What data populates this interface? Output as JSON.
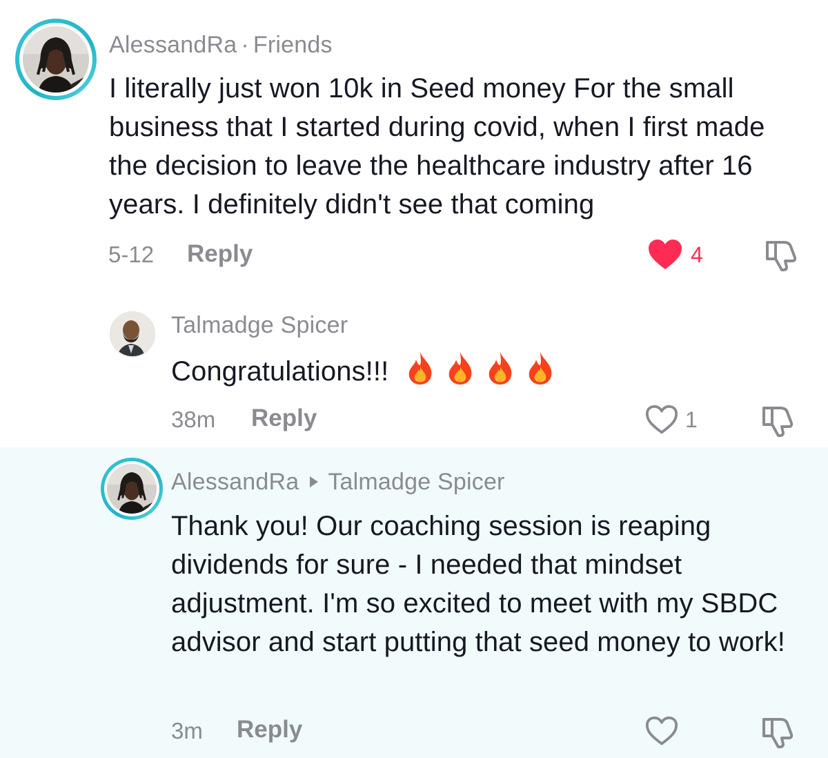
{
  "comments": [
    {
      "username": "AlessandRa",
      "separator": "·",
      "relation": "Friends",
      "text": "I literally just won 10k in Seed money For the small business that I started during covid, when I first made the decision to leave the healthcare industry after 16 years. I definitely didn't see that coming",
      "date": "5-12",
      "reply_label": "Reply",
      "likes": "4",
      "liked": true
    },
    {
      "username": "Talmadge Spicer",
      "text": "Congratulations!!!",
      "emoji": [
        "fire-icon",
        "fire-icon",
        "fire-icon",
        "fire-icon"
      ],
      "date": "38m",
      "reply_label": "Reply",
      "likes": "1",
      "liked": false
    },
    {
      "username": "AlessandRa",
      "reply_to": "Talmadge Spicer",
      "text": "Thank you! Our coaching session is reaping dividends for sure - I needed that mindset adjustment. I'm so excited to meet with my SBDC advisor and start putting that seed money to work!",
      "date": "3m",
      "reply_label": "Reply",
      "liked": false
    }
  ],
  "colors": {
    "like_red": "#fe2c55",
    "muted_text": "#8a8b91",
    "body_text": "#161823",
    "ring_teal": "#20b3c8",
    "highlight_bg": "#f1fbfc"
  }
}
